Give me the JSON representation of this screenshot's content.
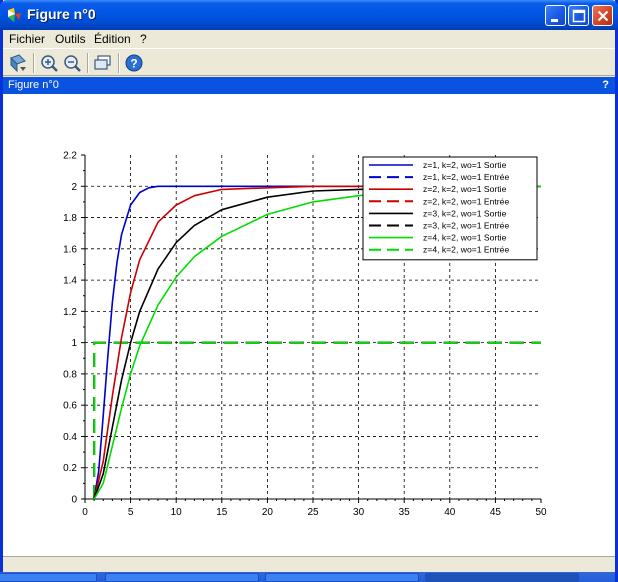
{
  "window": {
    "title": "Figure n°0"
  },
  "menu": {
    "items": [
      "Fichier",
      "Outils",
      "Édition",
      "?"
    ]
  },
  "toolbar": {
    "icons": [
      "rotate-icon",
      "zoom-in-icon",
      "zoom-out-icon",
      "datatip-icon",
      "help-icon"
    ]
  },
  "figure_bar": {
    "title": "Figure n°0",
    "help": "?"
  },
  "colors": {
    "accent": "#0a52e0",
    "series": [
      "#0000cc",
      "#cc0000",
      "#000000",
      "#00dd00"
    ]
  },
  "chart_data": {
    "type": "line",
    "title": "",
    "xlabel": "",
    "ylabel": "",
    "xlim": [
      0,
      50
    ],
    "ylim": [
      0,
      2.2
    ],
    "xticks": [
      0,
      5,
      10,
      15,
      20,
      25,
      30,
      35,
      40,
      45,
      50
    ],
    "yticks": [
      0,
      0.2,
      0.4,
      0.6,
      0.8,
      1,
      1.2,
      1.4,
      1.6,
      1.8,
      2,
      2.2
    ],
    "grid": true,
    "legend_position": "top-right",
    "series": [
      {
        "name": "z=1, k=2, wo=1 Sortie",
        "color": "#0000cc",
        "dash": "solid",
        "x": [
          1,
          1.5,
          2,
          2.5,
          3,
          3.5,
          4,
          5,
          6,
          7,
          8,
          10,
          50
        ],
        "y": [
          0,
          0.18,
          0.53,
          0.91,
          1.26,
          1.51,
          1.69,
          1.88,
          1.96,
          1.99,
          2.0,
          2.0,
          2.0
        ]
      },
      {
        "name": "z=1, k=2, wo=1 Entrée",
        "color": "#0000cc",
        "dash": "dash",
        "x": [
          1,
          1,
          50
        ],
        "y": [
          0,
          1,
          1
        ]
      },
      {
        "name": "z=2, k=2, wo=1 Sortie",
        "color": "#cc0000",
        "dash": "solid",
        "x": [
          1,
          2,
          3,
          4,
          5,
          6,
          8,
          10,
          12,
          15,
          20,
          25,
          30,
          50
        ],
        "y": [
          0,
          0.24,
          0.66,
          1.03,
          1.32,
          1.53,
          1.77,
          1.88,
          1.94,
          1.98,
          1.99,
          2.0,
          2.0,
          2.0
        ]
      },
      {
        "name": "z=2, k=2, wo=1 Entrée",
        "color": "#cc0000",
        "dash": "dash",
        "x": [
          1,
          1,
          50
        ],
        "y": [
          0,
          1,
          1
        ]
      },
      {
        "name": "z=3, k=2, wo=1 Sortie",
        "color": "#000000",
        "dash": "solid",
        "x": [
          1,
          2,
          3,
          4,
          5,
          6,
          8,
          10,
          12,
          15,
          20,
          25,
          30,
          40,
          50
        ],
        "y": [
          0,
          0.16,
          0.46,
          0.76,
          1.0,
          1.2,
          1.47,
          1.64,
          1.75,
          1.85,
          1.93,
          1.97,
          1.98,
          2.0,
          2.0
        ]
      },
      {
        "name": "z=3, k=2, wo=1 Entrée",
        "color": "#000000",
        "dash": "dash",
        "x": [
          1,
          1,
          50
        ],
        "y": [
          0,
          1,
          1
        ]
      },
      {
        "name": "z=4, k=2, wo=1 Sortie",
        "color": "#00dd00",
        "dash": "solid",
        "x": [
          1,
          2,
          3,
          4,
          5,
          6,
          8,
          10,
          12,
          15,
          20,
          25,
          30,
          35,
          40,
          50
        ],
        "y": [
          0,
          0.1,
          0.34,
          0.58,
          0.8,
          0.98,
          1.24,
          1.42,
          1.55,
          1.68,
          1.82,
          1.9,
          1.94,
          1.97,
          1.98,
          2.0
        ]
      },
      {
        "name": "z=4, k=2, wo=1 Entrée",
        "color": "#00dd00",
        "dash": "dash",
        "x": [
          1,
          1,
          50
        ],
        "y": [
          0,
          1,
          1
        ]
      }
    ]
  }
}
